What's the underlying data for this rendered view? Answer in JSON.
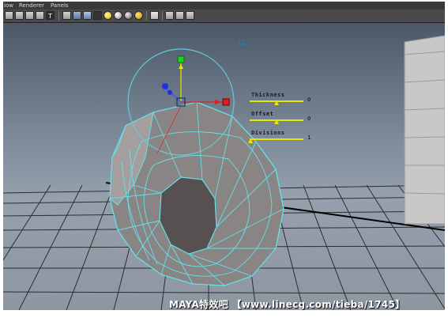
{
  "menu": {
    "items": [
      "iow",
      "Renderer",
      "Panels"
    ]
  },
  "toolbar": {
    "icons": [
      "camera-icon",
      "camera-attr-icon",
      "grid-icon",
      "bookmark-icon",
      "image-plane-icon",
      "wireframe-icon",
      "smooth-shade-icon",
      "textured-icon",
      "default-light-icon",
      "all-lights-icon",
      "shadows-icon",
      "isolate-icon",
      "xray-icon",
      "component-xray-icon",
      "gate-icon"
    ]
  },
  "poly_extrude": {
    "sliders": [
      {
        "label": "Thickness",
        "value": "0",
        "fraction": 0.5
      },
      {
        "label": "Offset",
        "value": "0",
        "fraction": 0.5
      },
      {
        "label": "Divisions",
        "value": "1",
        "fraction": 0.0
      }
    ]
  },
  "watermark": "MAYA特效吧 【www.linecg.com/tieba/1745】",
  "colors": {
    "viewport_top": "#4b5868",
    "viewport_bottom": "#8d96a1",
    "wireframe": "#66e0e8",
    "slider": "#e6e600",
    "manip_circle": "#6ac8d8"
  }
}
